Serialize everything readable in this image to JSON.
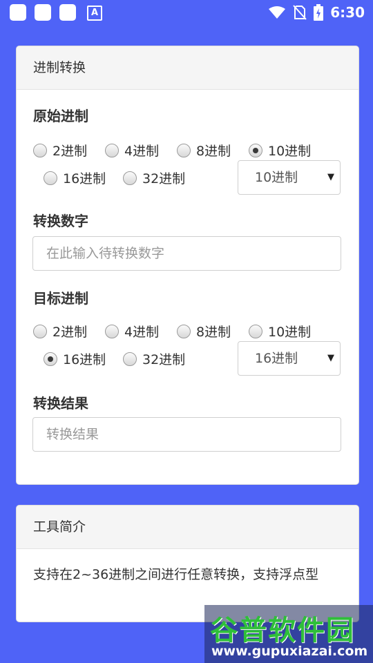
{
  "status_bar": {
    "time": "6:30",
    "notification_icon_letter": "A",
    "icons": [
      "app-notification-icon",
      "app-notification-icon",
      "app-notification-icon",
      "text-notification-icon",
      "wifi-icon",
      "no-sim-icon",
      "battery-charging-icon"
    ]
  },
  "converter": {
    "header": "进制转换",
    "source": {
      "title": "原始进制",
      "options": [
        "2进制",
        "4进制",
        "8进制",
        "10进制",
        "16进制",
        "32进制"
      ],
      "checked": "10进制",
      "select_value": "10进制"
    },
    "number": {
      "title": "转换数字",
      "placeholder": "在此输入待转换数字"
    },
    "target": {
      "title": "目标进制",
      "options": [
        "2进制",
        "4进制",
        "8进制",
        "10进制",
        "16进制",
        "32进制"
      ],
      "checked": "16进制",
      "select_value": "16进制"
    },
    "result": {
      "title": "转换结果",
      "placeholder": "转换结果"
    }
  },
  "intro": {
    "header": "工具简介",
    "text": "支持在2~36进制之间进行任意转换，支持浮点型"
  },
  "watermark": {
    "title": "谷普软件园",
    "url": "www.gupuxiazai.com"
  },
  "colors": {
    "background": "#4f63f7",
    "card": "#ffffff",
    "card_header": "#f5f5f5",
    "watermark_green": "#2fbf3a"
  }
}
